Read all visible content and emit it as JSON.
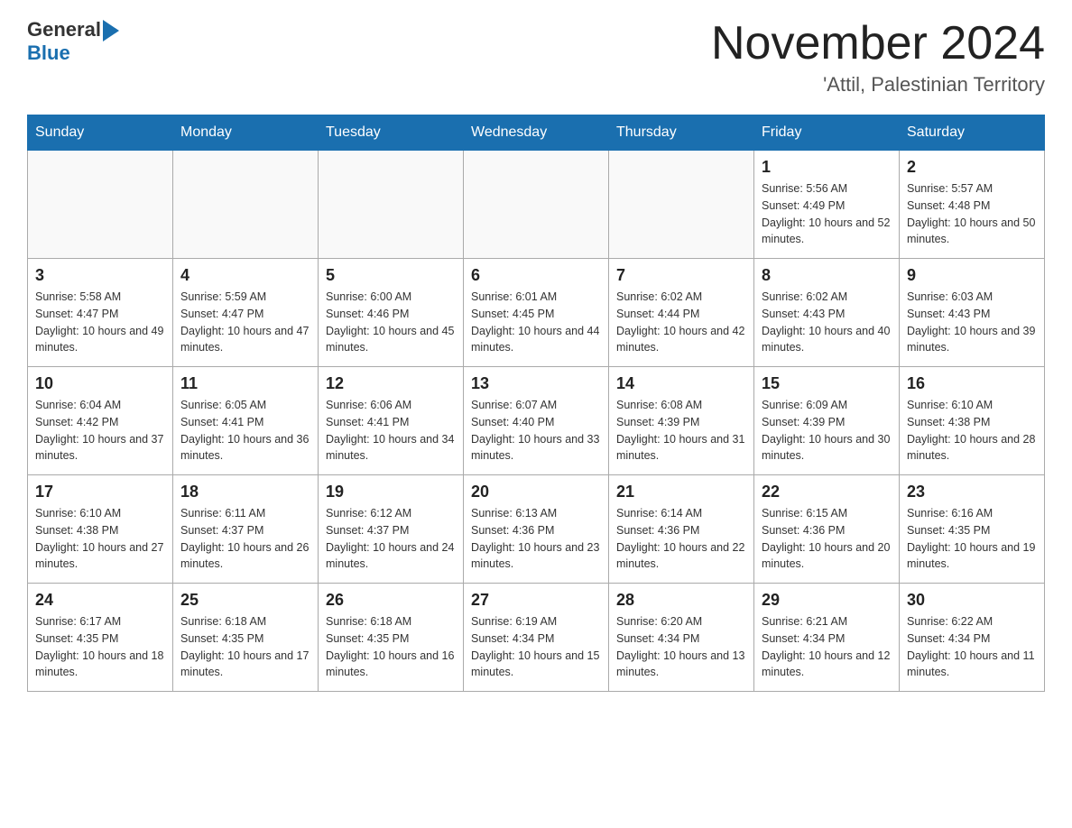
{
  "header": {
    "logo_general": "General",
    "logo_blue": "Blue",
    "title": "November 2024",
    "subtitle": "'Attil, Palestinian Territory"
  },
  "days_of_week": [
    "Sunday",
    "Monday",
    "Tuesday",
    "Wednesday",
    "Thursday",
    "Friday",
    "Saturday"
  ],
  "weeks": [
    [
      {
        "day": "",
        "info": ""
      },
      {
        "day": "",
        "info": ""
      },
      {
        "day": "",
        "info": ""
      },
      {
        "day": "",
        "info": ""
      },
      {
        "day": "",
        "info": ""
      },
      {
        "day": "1",
        "info": "Sunrise: 5:56 AM\nSunset: 4:49 PM\nDaylight: 10 hours and 52 minutes."
      },
      {
        "day": "2",
        "info": "Sunrise: 5:57 AM\nSunset: 4:48 PM\nDaylight: 10 hours and 50 minutes."
      }
    ],
    [
      {
        "day": "3",
        "info": "Sunrise: 5:58 AM\nSunset: 4:47 PM\nDaylight: 10 hours and 49 minutes."
      },
      {
        "day": "4",
        "info": "Sunrise: 5:59 AM\nSunset: 4:47 PM\nDaylight: 10 hours and 47 minutes."
      },
      {
        "day": "5",
        "info": "Sunrise: 6:00 AM\nSunset: 4:46 PM\nDaylight: 10 hours and 45 minutes."
      },
      {
        "day": "6",
        "info": "Sunrise: 6:01 AM\nSunset: 4:45 PM\nDaylight: 10 hours and 44 minutes."
      },
      {
        "day": "7",
        "info": "Sunrise: 6:02 AM\nSunset: 4:44 PM\nDaylight: 10 hours and 42 minutes."
      },
      {
        "day": "8",
        "info": "Sunrise: 6:02 AM\nSunset: 4:43 PM\nDaylight: 10 hours and 40 minutes."
      },
      {
        "day": "9",
        "info": "Sunrise: 6:03 AM\nSunset: 4:43 PM\nDaylight: 10 hours and 39 minutes."
      }
    ],
    [
      {
        "day": "10",
        "info": "Sunrise: 6:04 AM\nSunset: 4:42 PM\nDaylight: 10 hours and 37 minutes."
      },
      {
        "day": "11",
        "info": "Sunrise: 6:05 AM\nSunset: 4:41 PM\nDaylight: 10 hours and 36 minutes."
      },
      {
        "day": "12",
        "info": "Sunrise: 6:06 AM\nSunset: 4:41 PM\nDaylight: 10 hours and 34 minutes."
      },
      {
        "day": "13",
        "info": "Sunrise: 6:07 AM\nSunset: 4:40 PM\nDaylight: 10 hours and 33 minutes."
      },
      {
        "day": "14",
        "info": "Sunrise: 6:08 AM\nSunset: 4:39 PM\nDaylight: 10 hours and 31 minutes."
      },
      {
        "day": "15",
        "info": "Sunrise: 6:09 AM\nSunset: 4:39 PM\nDaylight: 10 hours and 30 minutes."
      },
      {
        "day": "16",
        "info": "Sunrise: 6:10 AM\nSunset: 4:38 PM\nDaylight: 10 hours and 28 minutes."
      }
    ],
    [
      {
        "day": "17",
        "info": "Sunrise: 6:10 AM\nSunset: 4:38 PM\nDaylight: 10 hours and 27 minutes."
      },
      {
        "day": "18",
        "info": "Sunrise: 6:11 AM\nSunset: 4:37 PM\nDaylight: 10 hours and 26 minutes."
      },
      {
        "day": "19",
        "info": "Sunrise: 6:12 AM\nSunset: 4:37 PM\nDaylight: 10 hours and 24 minutes."
      },
      {
        "day": "20",
        "info": "Sunrise: 6:13 AM\nSunset: 4:36 PM\nDaylight: 10 hours and 23 minutes."
      },
      {
        "day": "21",
        "info": "Sunrise: 6:14 AM\nSunset: 4:36 PM\nDaylight: 10 hours and 22 minutes."
      },
      {
        "day": "22",
        "info": "Sunrise: 6:15 AM\nSunset: 4:36 PM\nDaylight: 10 hours and 20 minutes."
      },
      {
        "day": "23",
        "info": "Sunrise: 6:16 AM\nSunset: 4:35 PM\nDaylight: 10 hours and 19 minutes."
      }
    ],
    [
      {
        "day": "24",
        "info": "Sunrise: 6:17 AM\nSunset: 4:35 PM\nDaylight: 10 hours and 18 minutes."
      },
      {
        "day": "25",
        "info": "Sunrise: 6:18 AM\nSunset: 4:35 PM\nDaylight: 10 hours and 17 minutes."
      },
      {
        "day": "26",
        "info": "Sunrise: 6:18 AM\nSunset: 4:35 PM\nDaylight: 10 hours and 16 minutes."
      },
      {
        "day": "27",
        "info": "Sunrise: 6:19 AM\nSunset: 4:34 PM\nDaylight: 10 hours and 15 minutes."
      },
      {
        "day": "28",
        "info": "Sunrise: 6:20 AM\nSunset: 4:34 PM\nDaylight: 10 hours and 13 minutes."
      },
      {
        "day": "29",
        "info": "Sunrise: 6:21 AM\nSunset: 4:34 PM\nDaylight: 10 hours and 12 minutes."
      },
      {
        "day": "30",
        "info": "Sunrise: 6:22 AM\nSunset: 4:34 PM\nDaylight: 10 hours and 11 minutes."
      }
    ]
  ]
}
